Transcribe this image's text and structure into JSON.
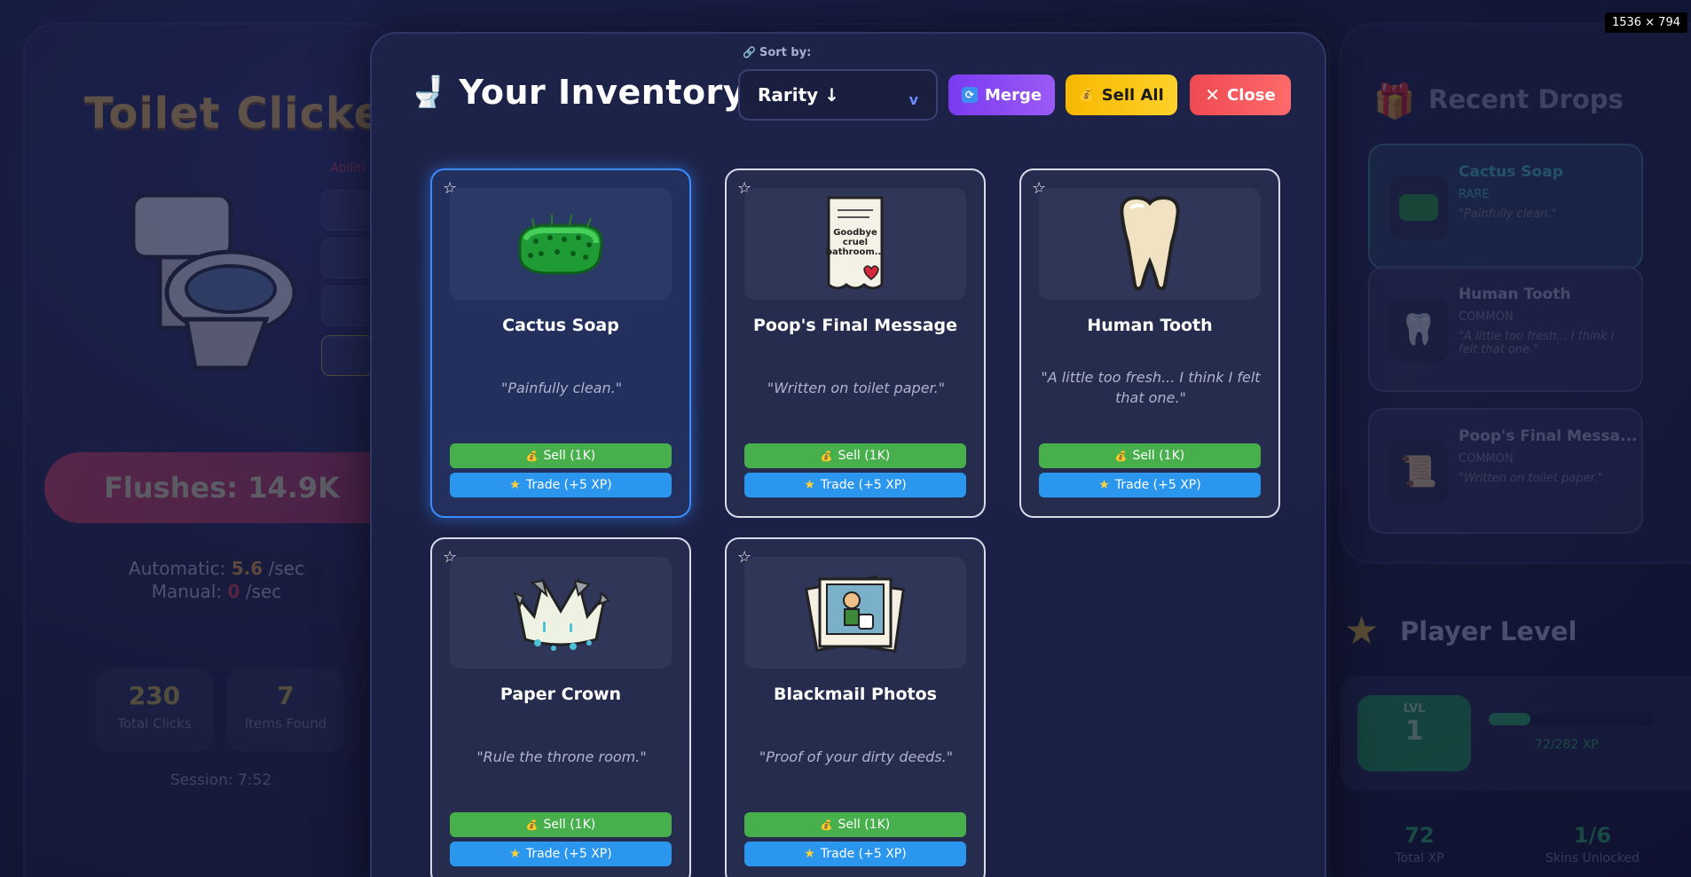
{
  "background": {
    "game_title": "Toilet Clicker",
    "abilities_label": "Abiliti",
    "flushes": "Flushes: 14.9K",
    "rates": {
      "automatic_label": "Automatic:",
      "automatic_value": "5.6",
      "manual_label": "Manual:",
      "manual_value": "0",
      "unit": "/sec"
    },
    "stats": [
      {
        "value": "230",
        "label": "Total Clicks"
      },
      {
        "value": "7",
        "label": "Items Found"
      }
    ],
    "session": "Session: 7:52",
    "recent_drops": {
      "title": "Recent Drops",
      "items": [
        {
          "name": "Cactus Soap",
          "rarity": "RARE",
          "desc": "\"Painfully clean.\""
        },
        {
          "name": "Human Tooth",
          "rarity": "COMMON",
          "desc": "\"A little too fresh... I think I felt that one.\""
        },
        {
          "name": "Poop's Final Messa...",
          "rarity": "COMMON",
          "desc": "\"Written on toilet paper.\""
        }
      ]
    },
    "player_level": {
      "title": "Player Level",
      "lvl_label": "LVL",
      "level": "1",
      "xp_text": "72/282 XP",
      "xp_progress": 0.255,
      "stats": [
        {
          "value": "72",
          "label": "Total XP"
        },
        {
          "value": "1/6",
          "label": "Skins Unlocked"
        }
      ]
    }
  },
  "dimension_badge": "1536 × 794",
  "modal": {
    "title": "Your Inventory",
    "sort": {
      "label": "Sort by:",
      "value": "Rarity ↓"
    },
    "buttons": {
      "merge": "Merge",
      "sell_all": "Sell All",
      "close": "Close"
    }
  },
  "items": [
    {
      "name": "Cactus Soap",
      "desc": "\"Painfully clean.\"",
      "sell": "Sell (1K)",
      "trade": "Trade (+5 XP)"
    },
    {
      "name": "Poop's Final Message",
      "desc": "\"Written on toilet paper.\"",
      "sell": "Sell (1K)",
      "trade": "Trade (+5 XP)"
    },
    {
      "name": "Human Tooth",
      "desc": "\"A little too fresh... I think I felt that one.\"",
      "sell": "Sell (1K)",
      "trade": "Trade (+5 XP)"
    },
    {
      "name": "Paper Crown",
      "desc": "\"Rule the throne room.\"",
      "sell": "Sell (1K)",
      "trade": "Trade (+5 XP)"
    },
    {
      "name": "Blackmail Photos",
      "desc": "\"Proof of your dirty deeds.\"",
      "sell": "Sell (1K)",
      "trade": "Trade (+5 XP)"
    }
  ],
  "images": {
    "note_text": "Goodbye cruel bathroom..."
  }
}
